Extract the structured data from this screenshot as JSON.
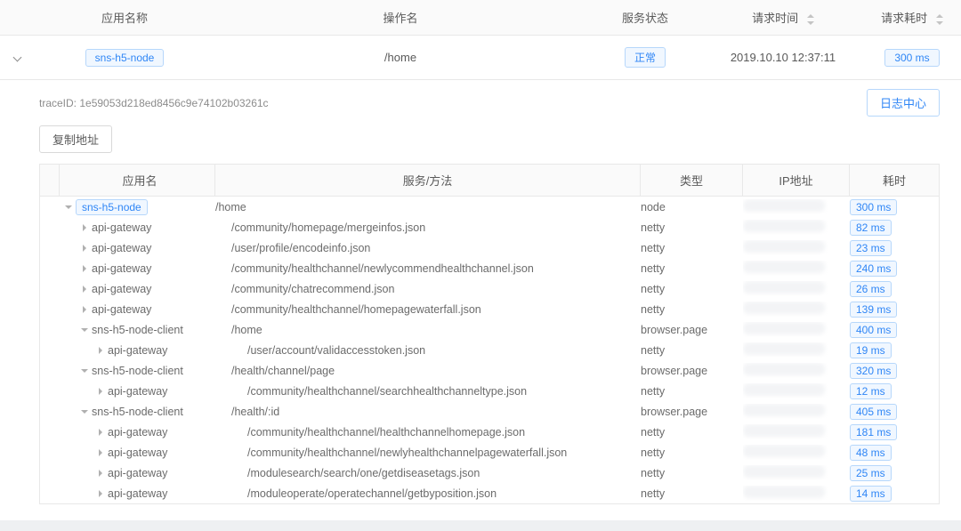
{
  "top": {
    "headers": {
      "app": "应用名称",
      "operation": "操作名",
      "status": "服务状态",
      "req_time": "请求时间",
      "req_duration": "请求耗时"
    },
    "values": {
      "app": "sns-h5-node",
      "operation": "/home",
      "status": "正常",
      "req_time": "2019.10.10 12:37:11",
      "req_duration": "300 ms"
    }
  },
  "trace": {
    "label": "traceID: 1e59053d218ed8456c9e74102b03261c",
    "log_center": "日志中心",
    "copy_addr": "复制地址"
  },
  "inner_headers": {
    "app": "应用名",
    "svc": "服务/方法",
    "type": "类型",
    "ip": "IP地址",
    "dur": "耗时"
  },
  "rows": [
    {
      "depth": 0,
      "caret": "down",
      "app": "sns-h5-node",
      "app_tag": true,
      "svc": "/home",
      "type": "node",
      "dur": "300 ms"
    },
    {
      "depth": 1,
      "caret": "right",
      "app": "api-gateway",
      "app_tag": false,
      "svc": "/community/homepage/mergeinfos.json",
      "type": "netty",
      "dur": "82 ms"
    },
    {
      "depth": 1,
      "caret": "right",
      "app": "api-gateway",
      "app_tag": false,
      "svc": "/user/profile/encodeinfo.json",
      "type": "netty",
      "dur": "23 ms"
    },
    {
      "depth": 1,
      "caret": "right",
      "app": "api-gateway",
      "app_tag": false,
      "svc": "/community/healthchannel/newlycommendhealthchannel.json",
      "type": "netty",
      "dur": "240 ms"
    },
    {
      "depth": 1,
      "caret": "right",
      "app": "api-gateway",
      "app_tag": false,
      "svc": "/community/chatrecommend.json",
      "type": "netty",
      "dur": "26 ms"
    },
    {
      "depth": 1,
      "caret": "right",
      "app": "api-gateway",
      "app_tag": false,
      "svc": "/community/healthchannel/homepagewaterfall.json",
      "type": "netty",
      "dur": "139 ms"
    },
    {
      "depth": 1,
      "caret": "down",
      "app": "sns-h5-node-client",
      "app_tag": false,
      "svc": "/home",
      "type": "browser.page",
      "dur": "400 ms"
    },
    {
      "depth": 2,
      "caret": "right",
      "app": "api-gateway",
      "app_tag": false,
      "svc": "/user/account/validaccesstoken.json",
      "type": "netty",
      "dur": "19 ms"
    },
    {
      "depth": 1,
      "caret": "down",
      "app": "sns-h5-node-client",
      "app_tag": false,
      "svc": "/health/channel/page",
      "type": "browser.page",
      "dur": "320 ms"
    },
    {
      "depth": 2,
      "caret": "right",
      "app": "api-gateway",
      "app_tag": false,
      "svc": "/community/healthchannel/searchhealthchanneltype.json",
      "type": "netty",
      "dur": "12 ms"
    },
    {
      "depth": 1,
      "caret": "down",
      "app": "sns-h5-node-client",
      "app_tag": false,
      "svc": "/health/:id",
      "type": "browser.page",
      "dur": "405 ms"
    },
    {
      "depth": 2,
      "caret": "right",
      "app": "api-gateway",
      "app_tag": false,
      "svc": "/community/healthchannel/healthchannelhomepage.json",
      "type": "netty",
      "dur": "181 ms"
    },
    {
      "depth": 2,
      "caret": "right",
      "app": "api-gateway",
      "app_tag": false,
      "svc": "/community/healthchannel/newlyhealthchannelpagewaterfall.json",
      "type": "netty",
      "dur": "48 ms"
    },
    {
      "depth": 2,
      "caret": "right",
      "app": "api-gateway",
      "app_tag": false,
      "svc": "/modulesearch/search/one/getdiseasetags.json",
      "type": "netty",
      "dur": "25 ms"
    },
    {
      "depth": 2,
      "caret": "right",
      "app": "api-gateway",
      "app_tag": false,
      "svc": "/moduleoperate/operatechannel/getbyposition.json",
      "type": "netty",
      "dur": "14 ms"
    }
  ]
}
